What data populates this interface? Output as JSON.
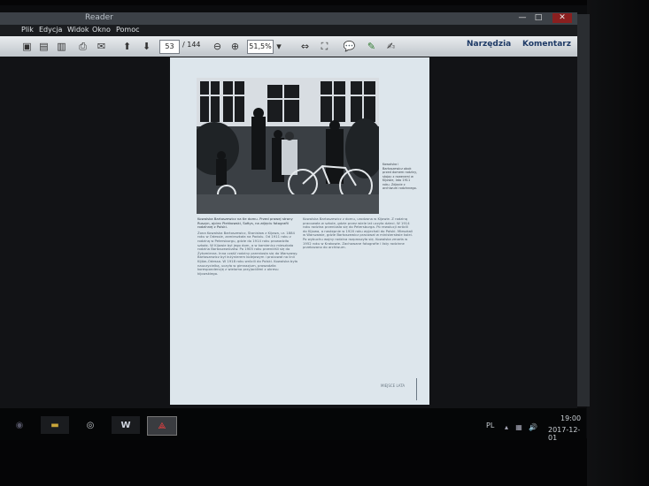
{
  "window": {
    "title": "Reader",
    "controls": [
      "—",
      "□",
      "✕"
    ]
  },
  "menubar": {
    "items": [
      "Plik",
      "Edycja",
      "Widok",
      "Okno",
      "Pomoc"
    ]
  },
  "toolbar": {
    "current_page": "53",
    "total_pages": "/ 144",
    "zoom": "51,5%",
    "tools_label": "Narzędzia",
    "comment_label": "Komentarz"
  },
  "document": {
    "caption_side": "Kowalska i Bartoszewicz obok przed domem rodziny, stojąc z rowerami w Kijowie, lato 1911 roku. Zdjęcie z archiwum rodzinnego.",
    "col1_lead": "Kowalska Bartoszewicz na tle domu. Przed prawej strony Ruszyn, ojciec Pieńkowski, Sołtys, na zdjęciu fotografii rodzinnej z Polski.",
    "col1": "Żona Kowalska Bartoszewicz, Stanisław z Kijowa, ur. 1884 roku w Odessie, zamieszkała na Podolu. Od 1911 roku z rodziną w Petersburgu, gdzie do 1914 roku prowadziła szkołę. W Kijowie był jego dom, a w kamienicy mieszkała rodzina Bartoszewiczów. Po 1905 roku przenieśli się do Żytomierza. Inna część rodziny przeniosła się do Warszawy. Bartoszewicz był inżynierem kolejowym i pracował na linii Kijów–Odessa. W 1918 roku wrócili do Polski. Kowalska była nauczycielką, uczyła w gimnazjum, prowadziła korespondencję z wieloma przyjaciółmi z okresu kijowskiego.",
    "col2": "Kowalska Bartoszewicz z domu, urodzona w Kijowie. Z rodziną pracowała w szkole, gdzie przez wiele lat uczyła dzieci. W 1914 roku rodzina przeniosła się do Petersburga. Po rewolucji wrócili do Kijowa, a następnie w 1920 roku wyjechali do Polski. Mieszkali w Warszawie, gdzie Bartoszewicz pracował w ministerstwie kolei. Po wybuchu wojny rodzina rozproszyła się. Kowalska zmarła w 1952 roku w Krakowie. Zachowane fotografie i listy rodzinne przekazano do archiwum.",
    "footer": "MIEJSCE LATA"
  },
  "taskbar": {
    "apps": [
      "start",
      "explorer",
      "chrome",
      "word",
      "acrobat"
    ],
    "lang": "PL",
    "time": "19:00",
    "date": "2017-12-01"
  }
}
